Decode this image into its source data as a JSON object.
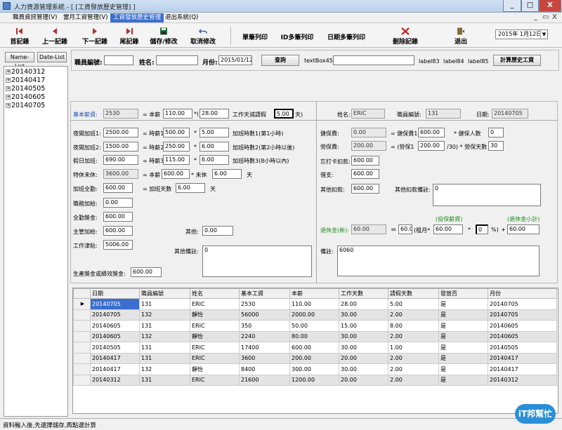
{
  "window": {
    "title": "人力資源管理系統 - [ [工資發放歷史管理] ]",
    "min": "_",
    "max": "□",
    "close": "X"
  },
  "menu": [
    "職員資訊管理(V)",
    "當月工資管理(V)",
    "工資發放歷史管理",
    "退出系統(Q)"
  ],
  "mdi": {
    "min": "_",
    "restore": "▭",
    "close": "X"
  },
  "toolbar": {
    "first": "首記錄",
    "prev": "上一記錄",
    "next": "下一記錄",
    "last": "尾記錄",
    "save": "儲存/修改",
    "cancel": "取消修改",
    "print_single": "單筆列印",
    "print_id": "ID多筆列印",
    "print_date": "日期多筆列印",
    "delete": "刪除記錄",
    "exit": "退出",
    "date": "2015年 1月12日"
  },
  "left": {
    "name_list": "Name-List",
    "date_list": "Date-List",
    "items": [
      "20140312",
      "20140417",
      "20140505",
      "20140605",
      "20140705"
    ]
  },
  "search": {
    "emp_no_label": "職員編號:",
    "emp_no": "",
    "name_label": "姓名:",
    "name": "",
    "month_label": "月份:",
    "month": "2015/01/12",
    "query": "查詢",
    "textbox_label": "textBox45",
    "textbox_value": "",
    "label83": "label83",
    "label84": "label84",
    "label85": "label85",
    "calc": "計算歷史工資"
  },
  "salary": {
    "base_label": "基本薪資:",
    "base": "2530",
    "eq_base": "= 本薪",
    "base_pay": "110.00",
    "mult_open": "*(",
    "work_days": "28.00",
    "workdays_label": "工作天減請假",
    "leave": "5.00",
    "days_close": "天)",
    "ot1_label": "夜間加班1:",
    "ot1": "2500.00",
    "ot1_rate_label": "= 時薪1",
    "ot1_rate": "500.00",
    "ot1_hrs": "5.00",
    "ot1_desc": "加班時數1(第1小時)",
    "ot2_label": "夜間加班2:",
    "ot2": "1500.00",
    "ot2_rate_label": "= 時薪2",
    "ot2_rate": "250.00",
    "ot2_hrs": "6.00",
    "ot2_desc": "加班時數2(第2小時以後)",
    "hol_label": "假日加班:",
    "hol": "690.00",
    "hol_rate_label": "= 時薪3",
    "hol_rate": "115.00",
    "hol_hrs": "6.00",
    "hol_desc": "加班時數3(8小時以內)",
    "rest_label": "特休未休:",
    "rest": "3600.00",
    "rest_eq": "= 本薪",
    "rest_pay": "600.00",
    "rest_unused_label": "* 未休",
    "rest_unused": "6.00",
    "rest_days": "天",
    "ot_allow_label": "加班全勤:",
    "ot_allow": "600.00",
    "ot_allow_eq": "= 加班天數",
    "ot_allow_days": "6.00",
    "ot_allow_unit": "天",
    "duty_label": "職務加給:",
    "duty": "0.00",
    "attend_label": "全勤獎金:",
    "attend": "600.00",
    "mgr_label": "主管加給:",
    "mgr": "600.00",
    "other_label": "其他:",
    "other": "0.00",
    "total_label": "工作津貼:",
    "total": "5006.00",
    "other_note_label": "其他備註:",
    "other_note": "0",
    "bonus_label": "生產獎金或績效獎金:",
    "bonus": "600.00",
    "star": "*"
  },
  "right": {
    "name_label": "姓名:",
    "name": "ERIC",
    "emp_label": "職員編號:",
    "emp_no": "131",
    "date_label": "日期:",
    "date": "20140705",
    "health_label": "健保費:",
    "health": "0.00",
    "health_eq": "= 健保費1",
    "health_base": "600.00",
    "health_persons_label": "* 健保人數",
    "health_persons": "0",
    "labor_label": "勞保費:",
    "labor": "200.00",
    "labor_eq": "= (勞保1",
    "labor_base": "200.00",
    "labor_div": "/30) * 勞保天數",
    "labor_days": "30",
    "punch_label": "忘打卡扣款:",
    "punch": "600.00",
    "borrow_label": "借支:",
    "borrow": "600.00",
    "other_ded_label": "其他扣款:",
    "other_ded": "600.00",
    "other_ded_note_label": "其他扣款備註:",
    "other_ded_note": "0",
    "insured_label": "(投保薪資)",
    "retire_sub_label": "(退休金小計)",
    "retire_label": "退休金(新):",
    "retire": "60.00",
    "retire_eq": "=",
    "retire_a": "60.00",
    "retire_rent": "(租月*",
    "retire_b": "60.00",
    "retire_mult": "*",
    "retire_pct": "0",
    "retire_pct_unit": "%)",
    "retire_plus": "+",
    "retire_total": "60.00",
    "remark_label": "備註:",
    "remark": "6060"
  },
  "grid": {
    "columns": [
      "日期",
      "職員編號",
      "姓名",
      "基本工資",
      "本薪",
      "工作天數",
      "請假天數",
      "發放否",
      "月份"
    ],
    "rows": [
      [
        "20140705",
        "131",
        "ERIC",
        "2530",
        "110.00",
        "28.00",
        "5.00",
        "是",
        "20140705"
      ],
      [
        "20140705",
        "132",
        "靜怡",
        "56000",
        "2000.00",
        "30.00",
        "2.00",
        "是",
        "20140705"
      ],
      [
        "20140605",
        "131",
        "ERIC",
        "350",
        "50.00",
        "15.00",
        "8.00",
        "是",
        "20140605"
      ],
      [
        "20140605",
        "132",
        "靜怡",
        "2240",
        "80.00",
        "30.00",
        "2.00",
        "是",
        "20140605"
      ],
      [
        "20140505",
        "131",
        "ERIC",
        "17400",
        "600.00",
        "30.00",
        "1.00",
        "是",
        "20140505"
      ],
      [
        "20140417",
        "131",
        "ERIC",
        "3600",
        "200.00",
        "20.00",
        "2.00",
        "是",
        "20140417"
      ],
      [
        "20140417",
        "132",
        "靜怡",
        "8400",
        "300.00",
        "30.00",
        "2.00",
        "是",
        "20140417"
      ],
      [
        "20140312",
        "131",
        "ERIC",
        "21600",
        "1200.00",
        "20.00",
        "2.00",
        "是",
        "20140312"
      ]
    ]
  },
  "status": "資料輸入後,先選擇儲存,再點選計算",
  "watermark": "iT邦幫忙",
  "colors": {
    "accent": "#3a6fd0",
    "green": "#1a8a1a",
    "blue": "#2050b0"
  }
}
